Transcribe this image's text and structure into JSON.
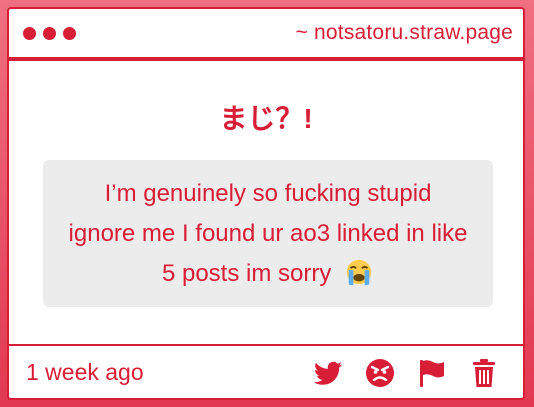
{
  "window": {
    "site": "~ notsatoru.straw.page"
  },
  "post": {
    "title": "まじ？!",
    "message": "I’m genuinely so fucking stupid ignore me I found ur ao3 linked in like 5 posts im sorry",
    "emoji": "loudly-crying-face-emoji"
  },
  "footer": {
    "timestamp": "1 week ago",
    "actions": [
      "twitter-icon",
      "angry-face-icon",
      "flag-icon",
      "trash-icon"
    ]
  },
  "colors": {
    "accent": "#d81d36",
    "message_bg": "#ececed",
    "background": "#e85066"
  }
}
